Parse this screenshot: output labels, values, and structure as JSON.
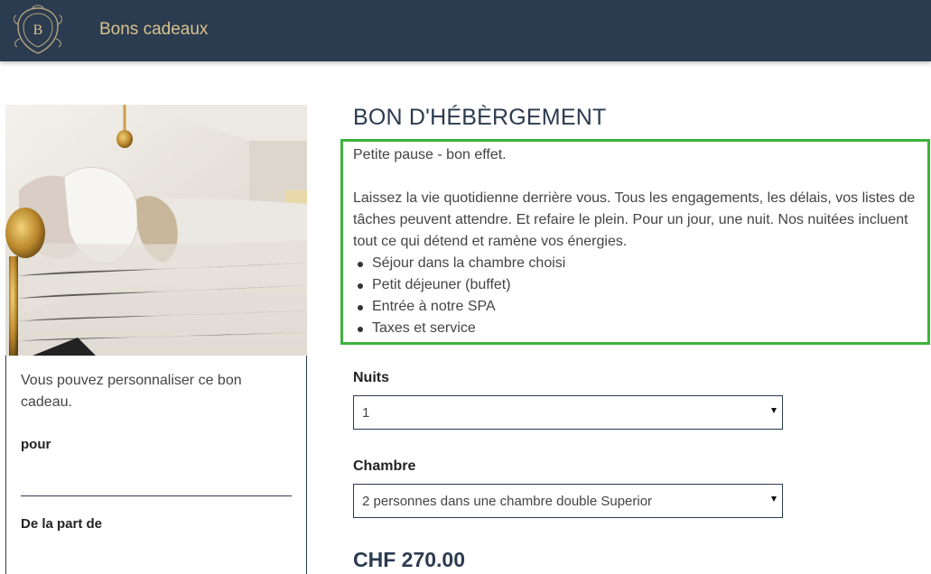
{
  "header": {
    "logo_letter": "B",
    "brand": "Bons cadeaux"
  },
  "card": {
    "intro": "Vous pouvez personnaliser ce bon cadeau.",
    "for_label": "pour",
    "from_label": "De la part de"
  },
  "main": {
    "title": "BON D'HÉBÈRGEMENT",
    "tagline": "Petite pause - bon effet.",
    "paragraph": "Laissez la vie quotidienne derrière vous. Tous les engagements, les délais, vos listes de tâches peuvent attendre. Et refaire le plein. Pour un jour, une nuit. Nos nuitées incluent tout ce qui détend et ramène vos énergies.",
    "bullets": [
      "Séjour dans la chambre choisi",
      "Petit déjeuner (buffet)",
      "Entrée à notre SPA",
      "Taxes et service"
    ],
    "nights_label": "Nuits",
    "nights_value": "1",
    "room_label": "Chambre",
    "room_value": "2 personnes dans une chambre double Superior",
    "price": "CHF 270.00"
  },
  "colors": {
    "header_bg": "#2b3b50",
    "brand_gold": "#d8c28a",
    "highlight_green": "#3db33b"
  }
}
